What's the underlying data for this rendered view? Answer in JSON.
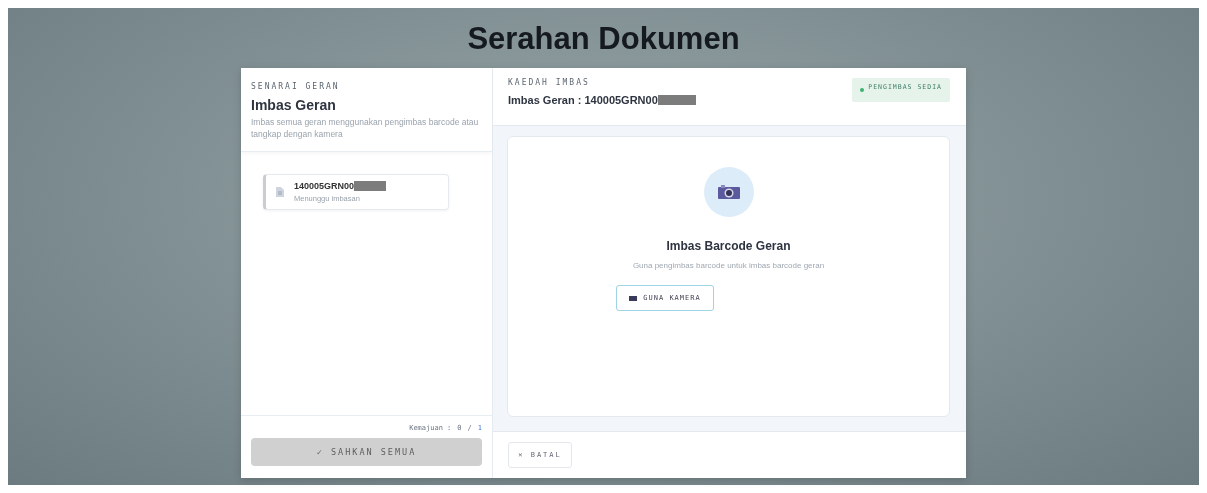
{
  "title": "Serahan Dokumen",
  "list_panel": {
    "eyebrow": "SENARAI GERAN",
    "heading": "Imbas Geran",
    "description": "Imbas semua geran menggunakan pengimbas barcode atau tangkap dengan kamera",
    "items": [
      {
        "code": "140005GRN00",
        "status": "Menunggu imbasan"
      }
    ],
    "progress_label": "Kemajuan :",
    "progress_done": "0",
    "progress_sep": "/",
    "progress_total": "1",
    "approve_button": {
      "label": "✓ SAHKAN SEMUA",
      "disabled": true
    }
  },
  "scan_panel": {
    "eyebrow": "KAEDAH IMBAS",
    "heading": "Imbas Geran : 140005GRN00",
    "scanner_status": {
      "label": "PENGIMBAS SEDIA",
      "ready": true
    },
    "prompt_title": "Imbas Barcode Geran",
    "prompt_text": "Guna pengimbas barcode untuk imbas barcode geran",
    "camera_button": "GUNA KAMERA",
    "cancel_button": "✕ BATAL"
  }
}
